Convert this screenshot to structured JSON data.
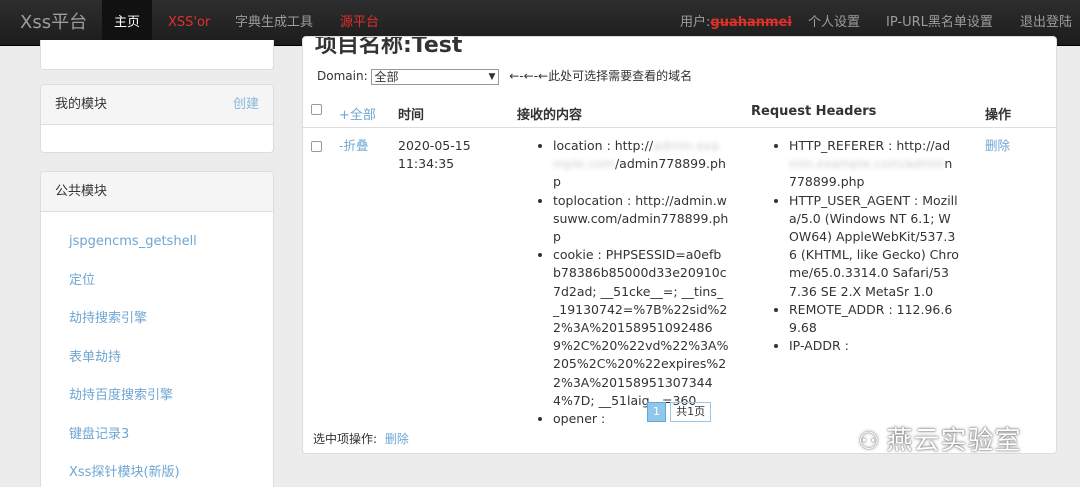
{
  "navbar": {
    "brand": "Xss平台",
    "home": "主页",
    "xssor": "XSS'or",
    "dict": "字典生成工具",
    "source": "源平台",
    "user_label": "用户:",
    "username": "guahanmei",
    "settings": "个人设置",
    "ip_blacklist": "IP-URL黑名单设置",
    "logout": "退出登陆"
  },
  "sidebar": {
    "my_modules": {
      "title": "我的模块",
      "create": "创建"
    },
    "public_modules": {
      "title": "公共模块",
      "items": [
        {
          "label": "jspgencms_getshell"
        },
        {
          "label": "定位"
        },
        {
          "label": "劫持搜索引擎"
        },
        {
          "label": "表单劫持"
        },
        {
          "label": "劫持百度搜索引擎"
        },
        {
          "label": "键盘记录3"
        },
        {
          "label": "Xss探针模块(新版)"
        }
      ]
    }
  },
  "main": {
    "heading": "项目名称:Test",
    "domain_label": "Domain:",
    "domain_selected": "全部",
    "domain_hint": "←-←-←此处可选择需要查看的域名",
    "columns": {
      "expand_all": "+全部",
      "time": "时间",
      "content": "接收的内容",
      "headers": "Request Headers",
      "action": "操作"
    },
    "row": {
      "collapse": "-折叠",
      "date": "2020-05-15",
      "time": "11:34:35",
      "content": {
        "location_prefix": "location : http://",
        "location_hidden": "admin.example.com",
        "location_suffix": "/admin778899.php",
        "toplocation": "toplocation : http://admin.wsuww.com/admin778899.php",
        "cookie": "cookie : PHPSESSID=a0efbb78386b85000d33e20910c7d2ad; __51cke__=; __tins__19130742=%7B%22sid%22%3A%201589510924869%2C%20%22vd%22%3A%205%2C%20%22expires%22%3A%201589513073444%7D; __51laig__=360",
        "opener": "opener :"
      },
      "headers": {
        "referer_prefix": "HTTP_REFERER : http://ad",
        "referer_hidden": "min.example.com/admin",
        "referer_suffix": "n778899.php",
        "user_agent": "HTTP_USER_AGENT : Mozilla/5.0 (Windows NT 6.1; WOW64) AppleWebKit/537.36 (KHTML, like Gecko) Chrome/65.0.3314.0 Safari/537.36 SE 2.X MetaSr 1.0",
        "remote_addr": "REMOTE_ADDR : 112.96.69.68",
        "ip_addr": "IP-ADDR :"
      },
      "delete": "删除"
    },
    "pager": {
      "current": "1",
      "total": "共1页"
    },
    "bulk_label": "选中项操作:",
    "bulk_delete": "删除"
  },
  "watermark": {
    "text": "燕云实验室"
  }
}
